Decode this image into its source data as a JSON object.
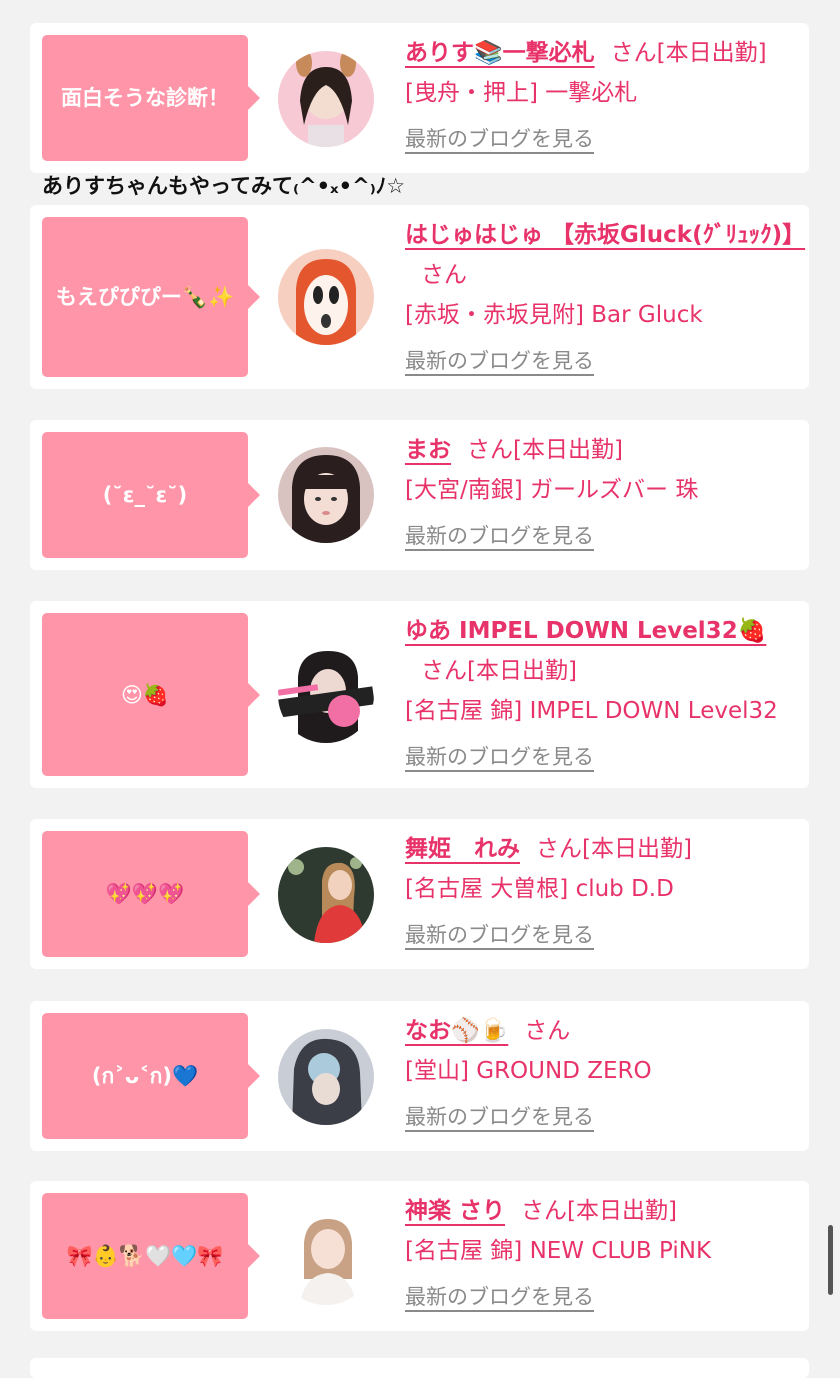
{
  "caption": "ありすちゃんもやってみて₍^•ₓ•^₎ﾉ☆",
  "blog_link_label": "最新のブログを見る",
  "colors": {
    "accent": "#e8336a",
    "bubble": "#ff95a8",
    "background": "#f2f2f2",
    "link_gray": "#8a8a8a"
  },
  "items": [
    {
      "bubble": "面白そうな診断！",
      "name": "ありす📚一撃必札",
      "san": "さん",
      "status": "[本日出勤]",
      "place": "[曳舟・押上] 一撃必札"
    },
    {
      "bubble": "もえぴぴぴー🍾✨",
      "name": "はじゅはじゅ 【赤坂Gluck(ｸﾞﾘｭｯｸ)】",
      "san": "さん",
      "status": "",
      "place": "[赤坂・赤坂見附] Bar Gluck"
    },
    {
      "bubble": "(˘ε_˘ε˘)",
      "name": "まお",
      "san": "さん",
      "status": "[本日出勤]",
      "place": "[大宮/南銀] ガールズバー 珠"
    },
    {
      "bubble": "😍🍓",
      "name": "ゆあ IMPEL DOWN Level32🍓",
      "san": "さん",
      "status": "[本日出勤]",
      "place": "[名古屋 錦] IMPEL DOWN Level32"
    },
    {
      "bubble": "💖💖💖",
      "name": "舞姫　れみ",
      "san": "さん",
      "status": "[本日出勤]",
      "place": "[名古屋 大曽根] club D.D"
    },
    {
      "bubble": "(ก˃ᴗ˂ก)💙",
      "name": "なお⚾🍺",
      "san": "さん",
      "status": "",
      "place": "[堂山] GROUND ZERO"
    },
    {
      "bubble": "🎀👶🐕🤍🩵🎀",
      "name": "神楽 さり",
      "san": "さん",
      "status": "[本日出勤]",
      "place": "[名古屋 錦] NEW CLUB PiNK"
    }
  ]
}
